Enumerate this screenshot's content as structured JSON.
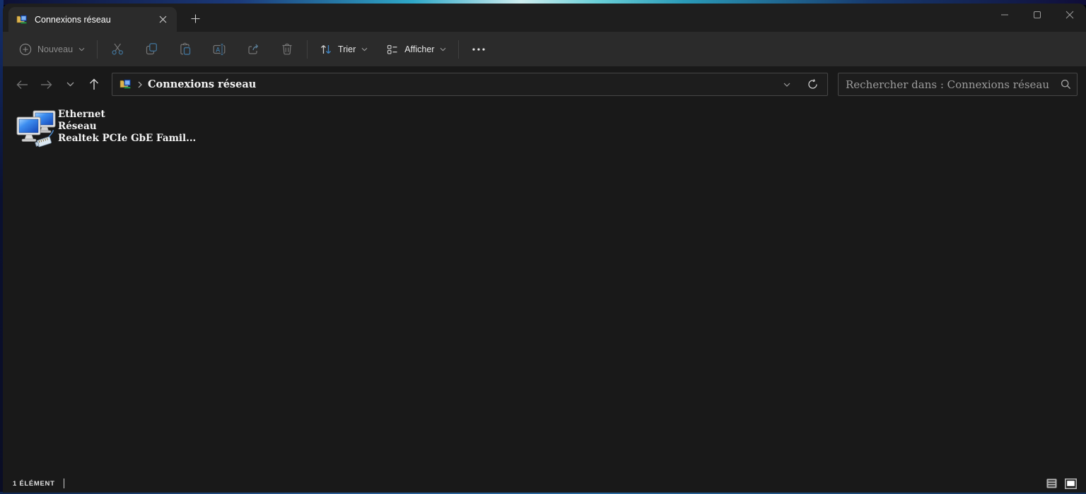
{
  "tab": {
    "title": "Connexions réseau"
  },
  "toolbar": {
    "new_label": "Nouveau",
    "sort_label": "Trier",
    "view_label": "Afficher"
  },
  "address_bar": {
    "path": "Connexions réseau"
  },
  "search": {
    "placeholder": "Rechercher dans : Connexions réseau"
  },
  "files": [
    {
      "name": "Ethernet",
      "status": "Réseau",
      "device": "Realtek PCIe GbE Famil..."
    }
  ],
  "status_bar": {
    "count": "1 élément"
  },
  "icons": [
    "network-connections-icon",
    "close-icon",
    "plus-icon",
    "circle-plus-icon",
    "cut-icon",
    "copy-icon",
    "paste-icon",
    "rename-icon",
    "share-icon",
    "delete-icon",
    "sort-icon",
    "view-layout-icon",
    "ellipsis-icon",
    "back-icon",
    "forward-icon",
    "recent-locations-chevron-icon",
    "up-icon",
    "address-dropdown-chevron-icon",
    "refresh-icon",
    "search-icon",
    "ethernet-adapter-icon",
    "details-view-icon",
    "large-icons-view-icon",
    "minimize-icon",
    "maximize-icon",
    "close-window-icon"
  ],
  "colors": {
    "tabbar_bg": "#1e1e1e",
    "commandbar_bg": "#2b2b2b",
    "window_bg": "#191919",
    "accent_steel_blue": "#3f6f93",
    "sort_arrow_blue": "#3f86c6",
    "text_primary": "#f2f2f2",
    "text_disabled": "#8a8a8a",
    "field_border": "#464646"
  }
}
